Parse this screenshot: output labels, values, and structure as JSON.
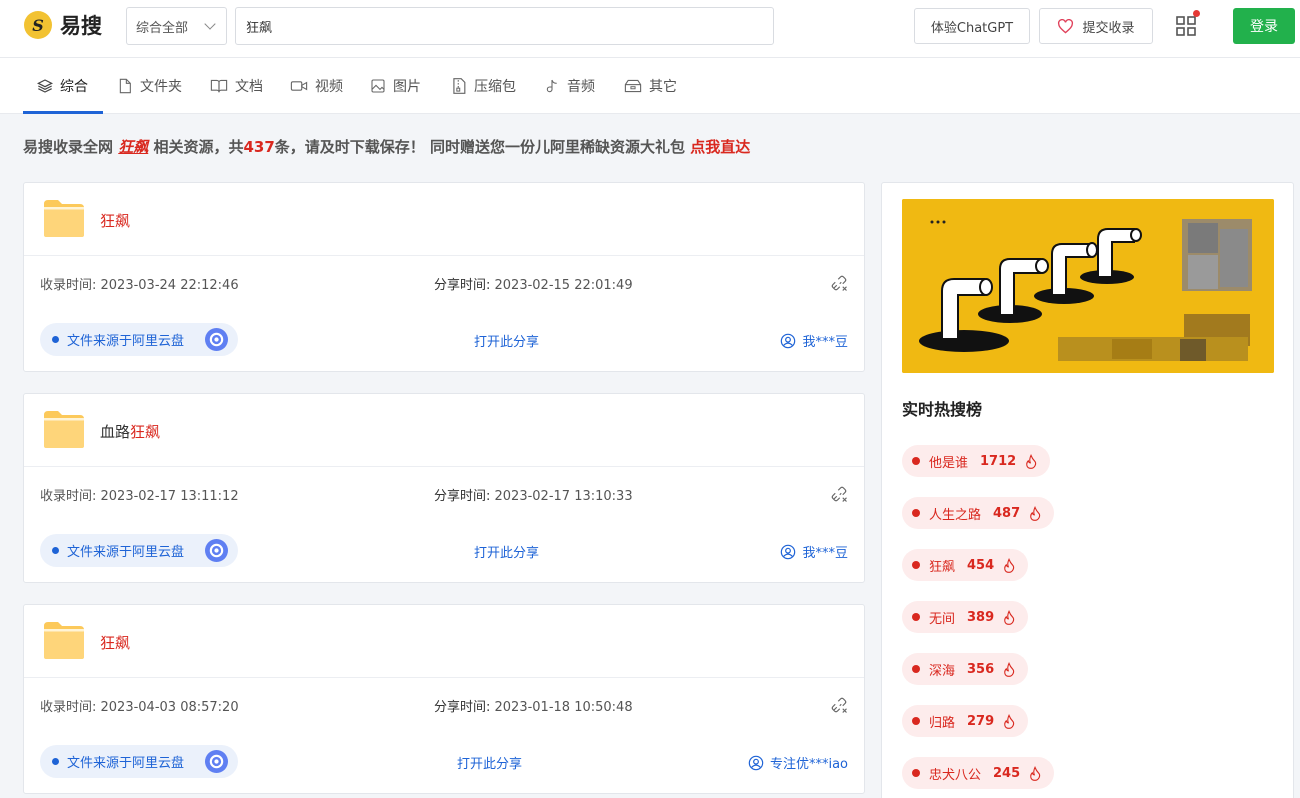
{
  "header": {
    "logo_text": "易搜",
    "scope_label": "综合全部",
    "search_value": "狂飙",
    "chatgpt_label": "体验ChatGPT",
    "submit_label": "提交收录",
    "login_label": "登录"
  },
  "tabs": [
    {
      "label": "综合",
      "icon": "layers-icon",
      "active": true
    },
    {
      "label": "文件夹",
      "icon": "file-icon"
    },
    {
      "label": "文档",
      "icon": "book-icon"
    },
    {
      "label": "视频",
      "icon": "video-icon"
    },
    {
      "label": "图片",
      "icon": "image-icon"
    },
    {
      "label": "压缩包",
      "icon": "zip-icon"
    },
    {
      "label": "音频",
      "icon": "music-icon"
    },
    {
      "label": "其它",
      "icon": "box-icon"
    }
  ],
  "notice": {
    "prefix": "易搜收录全网 ",
    "keyword": "狂飙",
    "middle": " 相关资源，共",
    "count": "437",
    "suffix": "条，请及时下载保存！ 同时赠送您一份儿阿里稀缺资源大礼包 ",
    "link": "点我直达"
  },
  "results": [
    {
      "title_prefix": "",
      "title_highlight": "狂飙",
      "collected_label": "收录时间: ",
      "collected": "2023-03-24 22:12:46",
      "shared_label": "分享时间: ",
      "shared": "2023-02-15 22:01:49",
      "source": "文件来源于阿里云盘",
      "open": "打开此分享",
      "sharer": "我***豆"
    },
    {
      "title_prefix": "血路",
      "title_highlight": "狂飙",
      "collected_label": "收录时间: ",
      "collected": "2023-02-17 13:11:12",
      "shared_label": "分享时间: ",
      "shared": "2023-02-17 13:10:33",
      "source": "文件来源于阿里云盘",
      "open": "打开此分享",
      "sharer": "我***豆"
    },
    {
      "title_prefix": "",
      "title_highlight": "狂飙",
      "collected_label": "收录时间: ",
      "collected": "2023-04-03 08:57:20",
      "shared_label": "分享时间: ",
      "shared": "2023-01-18 10:50:48",
      "source": "文件来源于阿里云盘",
      "open": "打开此分享",
      "sharer": "专注优***iao"
    }
  ],
  "sidebar": {
    "hot_title": "实时热搜榜",
    "hot": [
      {
        "name": "他是谁",
        "count": "1712"
      },
      {
        "name": "人生之路",
        "count": "487"
      },
      {
        "name": "狂飙",
        "count": "454"
      },
      {
        "name": "无间",
        "count": "389"
      },
      {
        "name": "深海",
        "count": "356"
      },
      {
        "name": "归路",
        "count": "279"
      },
      {
        "name": "忠犬八公",
        "count": "245"
      }
    ]
  },
  "colors": {
    "accent": "#1e63d6",
    "highlight": "#d9281f",
    "login": "#22b14c",
    "banner": "#f0b912"
  }
}
